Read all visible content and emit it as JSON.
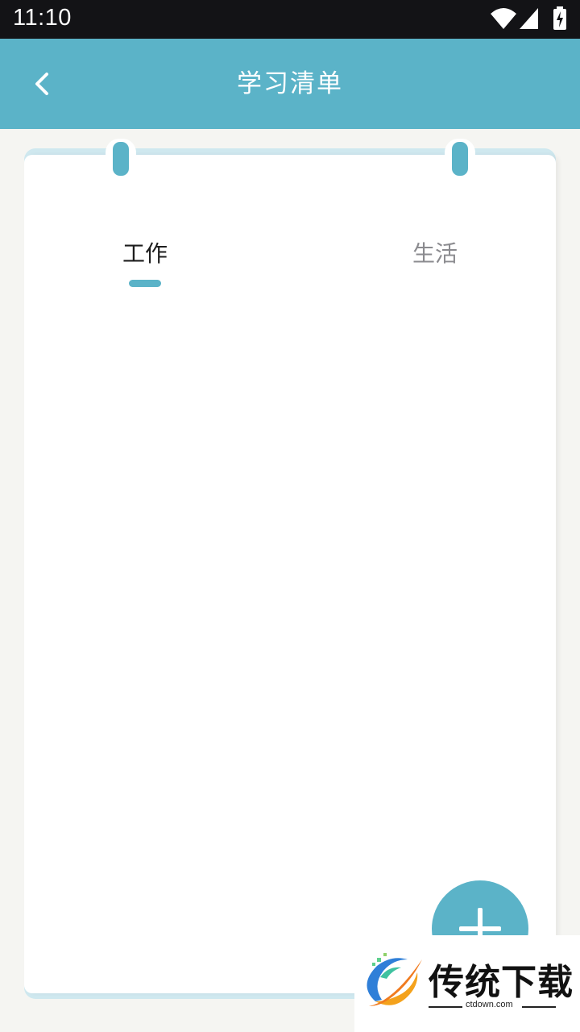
{
  "status_bar": {
    "time": "11:10",
    "icons": [
      "wifi-icon",
      "signal-icon",
      "battery-charging-icon"
    ]
  },
  "app_bar": {
    "title": "学习清单",
    "back_icon": "chevron-left-icon"
  },
  "tabs": [
    {
      "label": "工作",
      "selected": true
    },
    {
      "label": "生活",
      "selected": false
    }
  ],
  "fab": {
    "icon": "plus-icon"
  },
  "watermark": {
    "brand": "传统下载",
    "url": "ctdown.com"
  },
  "colors": {
    "accent": "#5bb3c8",
    "status_bar": "#131316",
    "background": "#f5f5f2"
  }
}
